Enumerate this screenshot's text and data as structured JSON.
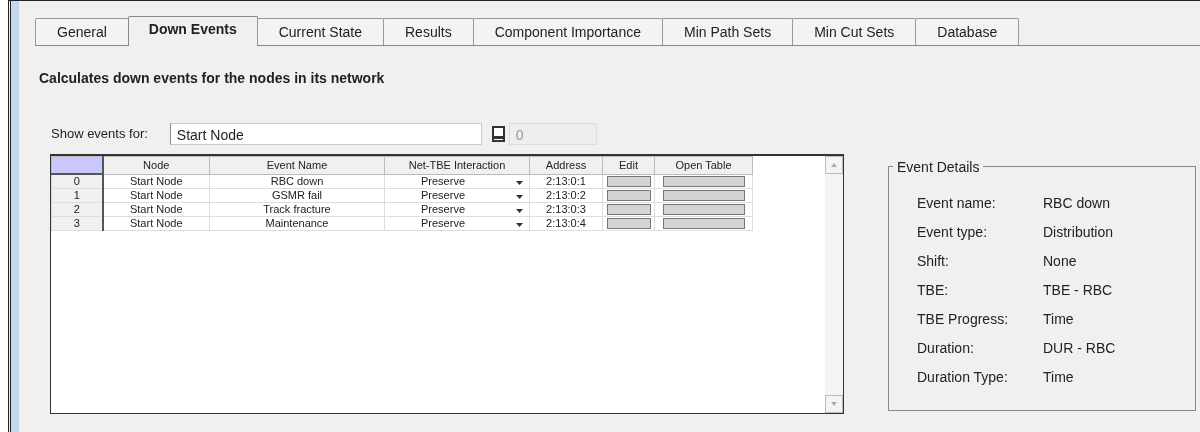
{
  "tabs": [
    {
      "label": "General",
      "selected": false
    },
    {
      "label": "Down Events",
      "selected": true
    },
    {
      "label": "Current State",
      "selected": false
    },
    {
      "label": "Results",
      "selected": false
    },
    {
      "label": "Component Importance",
      "selected": false
    },
    {
      "label": "Min Path Sets",
      "selected": false
    },
    {
      "label": "Min Cut Sets",
      "selected": false
    },
    {
      "label": "Database",
      "selected": false
    }
  ],
  "description": "Calculates down events for the nodes in its network",
  "show_events": {
    "label": "Show events for:",
    "value": "Start Node",
    "count": "0"
  },
  "table": {
    "columns": [
      "Node",
      "Event Name",
      "Net-TBE Interaction",
      "Address",
      "Edit",
      "Open Table"
    ],
    "rows": [
      {
        "index": "0",
        "node": "Start Node",
        "event_name": "RBC down",
        "interaction": "Preserve",
        "address": "2:13:0:1"
      },
      {
        "index": "1",
        "node": "Start Node",
        "event_name": "GSMR fail",
        "interaction": "Preserve",
        "address": "2:13:0:2"
      },
      {
        "index": "2",
        "node": "Start Node",
        "event_name": "Track fracture",
        "interaction": "Preserve",
        "address": "2:13:0:3"
      },
      {
        "index": "3",
        "node": "Start Node",
        "event_name": "Maintenance",
        "interaction": "Preserve",
        "address": "2:13:0:4"
      }
    ]
  },
  "event_details": {
    "title": "Event Details",
    "fields": [
      {
        "label": "Event name:",
        "value": "RBC down"
      },
      {
        "label": "Event type:",
        "value": "Distribution"
      },
      {
        "label": "Shift:",
        "value": "None"
      },
      {
        "label": "TBE:",
        "value": "TBE - RBC"
      },
      {
        "label": "TBE Progress:",
        "value": "Time"
      },
      {
        "label": "Duration:",
        "value": "DUR - RBC"
      },
      {
        "label": "Duration Type:",
        "value": "Time"
      }
    ]
  }
}
